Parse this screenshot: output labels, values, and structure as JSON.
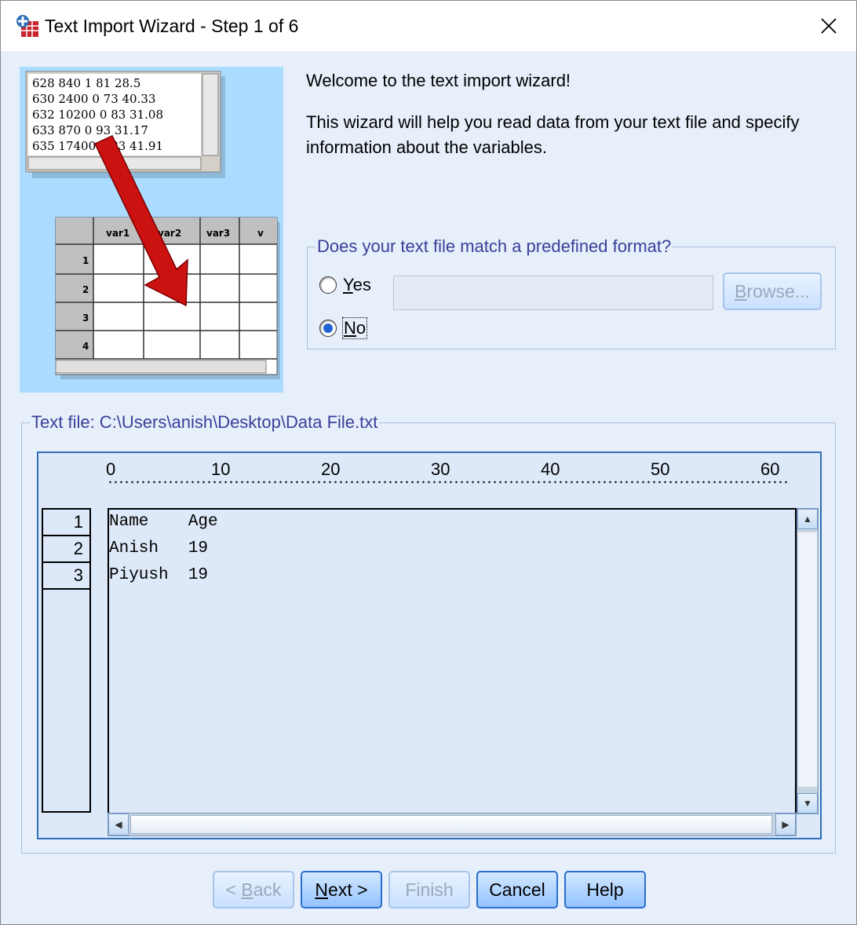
{
  "window": {
    "title": "Text Import Wizard - Step 1 of 6",
    "close_glyph": "✕"
  },
  "illustration": {
    "text_lines": [
      "628 840 1 81 28.5",
      "630 2400 0 73 40.33",
      "632 10200 0 83 31.08",
      "633 870 0 93 31.17",
      "635 17400 0 83 41.91"
    ],
    "columns": [
      "var1",
      "var2",
      "var3",
      "v"
    ],
    "rows": [
      "1",
      "2",
      "3",
      "4"
    ]
  },
  "intro": {
    "welcome": "Welcome to the text import wizard!",
    "description": "This wizard will help you read data from your text file and specify information about the variables."
  },
  "format_group": {
    "legend": "Does your text file match a predefined format?",
    "yes": {
      "first": "Y",
      "rest": "es",
      "checked": false
    },
    "no": {
      "first": "N",
      "rest": "o",
      "checked": true
    },
    "path_value": "",
    "browse": {
      "first": "B",
      "rest": "rowse..."
    }
  },
  "file_group": {
    "legend": "Text file:  C:\\Users\\anish\\Desktop\\Data File.txt",
    "ruler": [
      "0",
      "10",
      "20",
      "30",
      "40",
      "50",
      "60"
    ],
    "line_numbers": [
      "1",
      "2",
      "3"
    ],
    "lines": [
      "Name    Age",
      "Anish   19",
      "Piyush  19"
    ]
  },
  "buttons": {
    "back": {
      "prefix": "< ",
      "first": "B",
      "rest": "ack",
      "enabled": false
    },
    "next": {
      "first": "N",
      "rest": "ext >",
      "enabled": true
    },
    "finish": {
      "label": "Finish",
      "enabled": false
    },
    "cancel": {
      "label": "Cancel",
      "enabled": true
    },
    "help": {
      "label": "Help",
      "enabled": true
    }
  },
  "colors": {
    "dialog_bg": "#e6effa",
    "accent": "#2a6fd0",
    "legend_text": "#3a3f9a",
    "illustration_bg": "#abdcff",
    "arrow": "#cc1111"
  }
}
